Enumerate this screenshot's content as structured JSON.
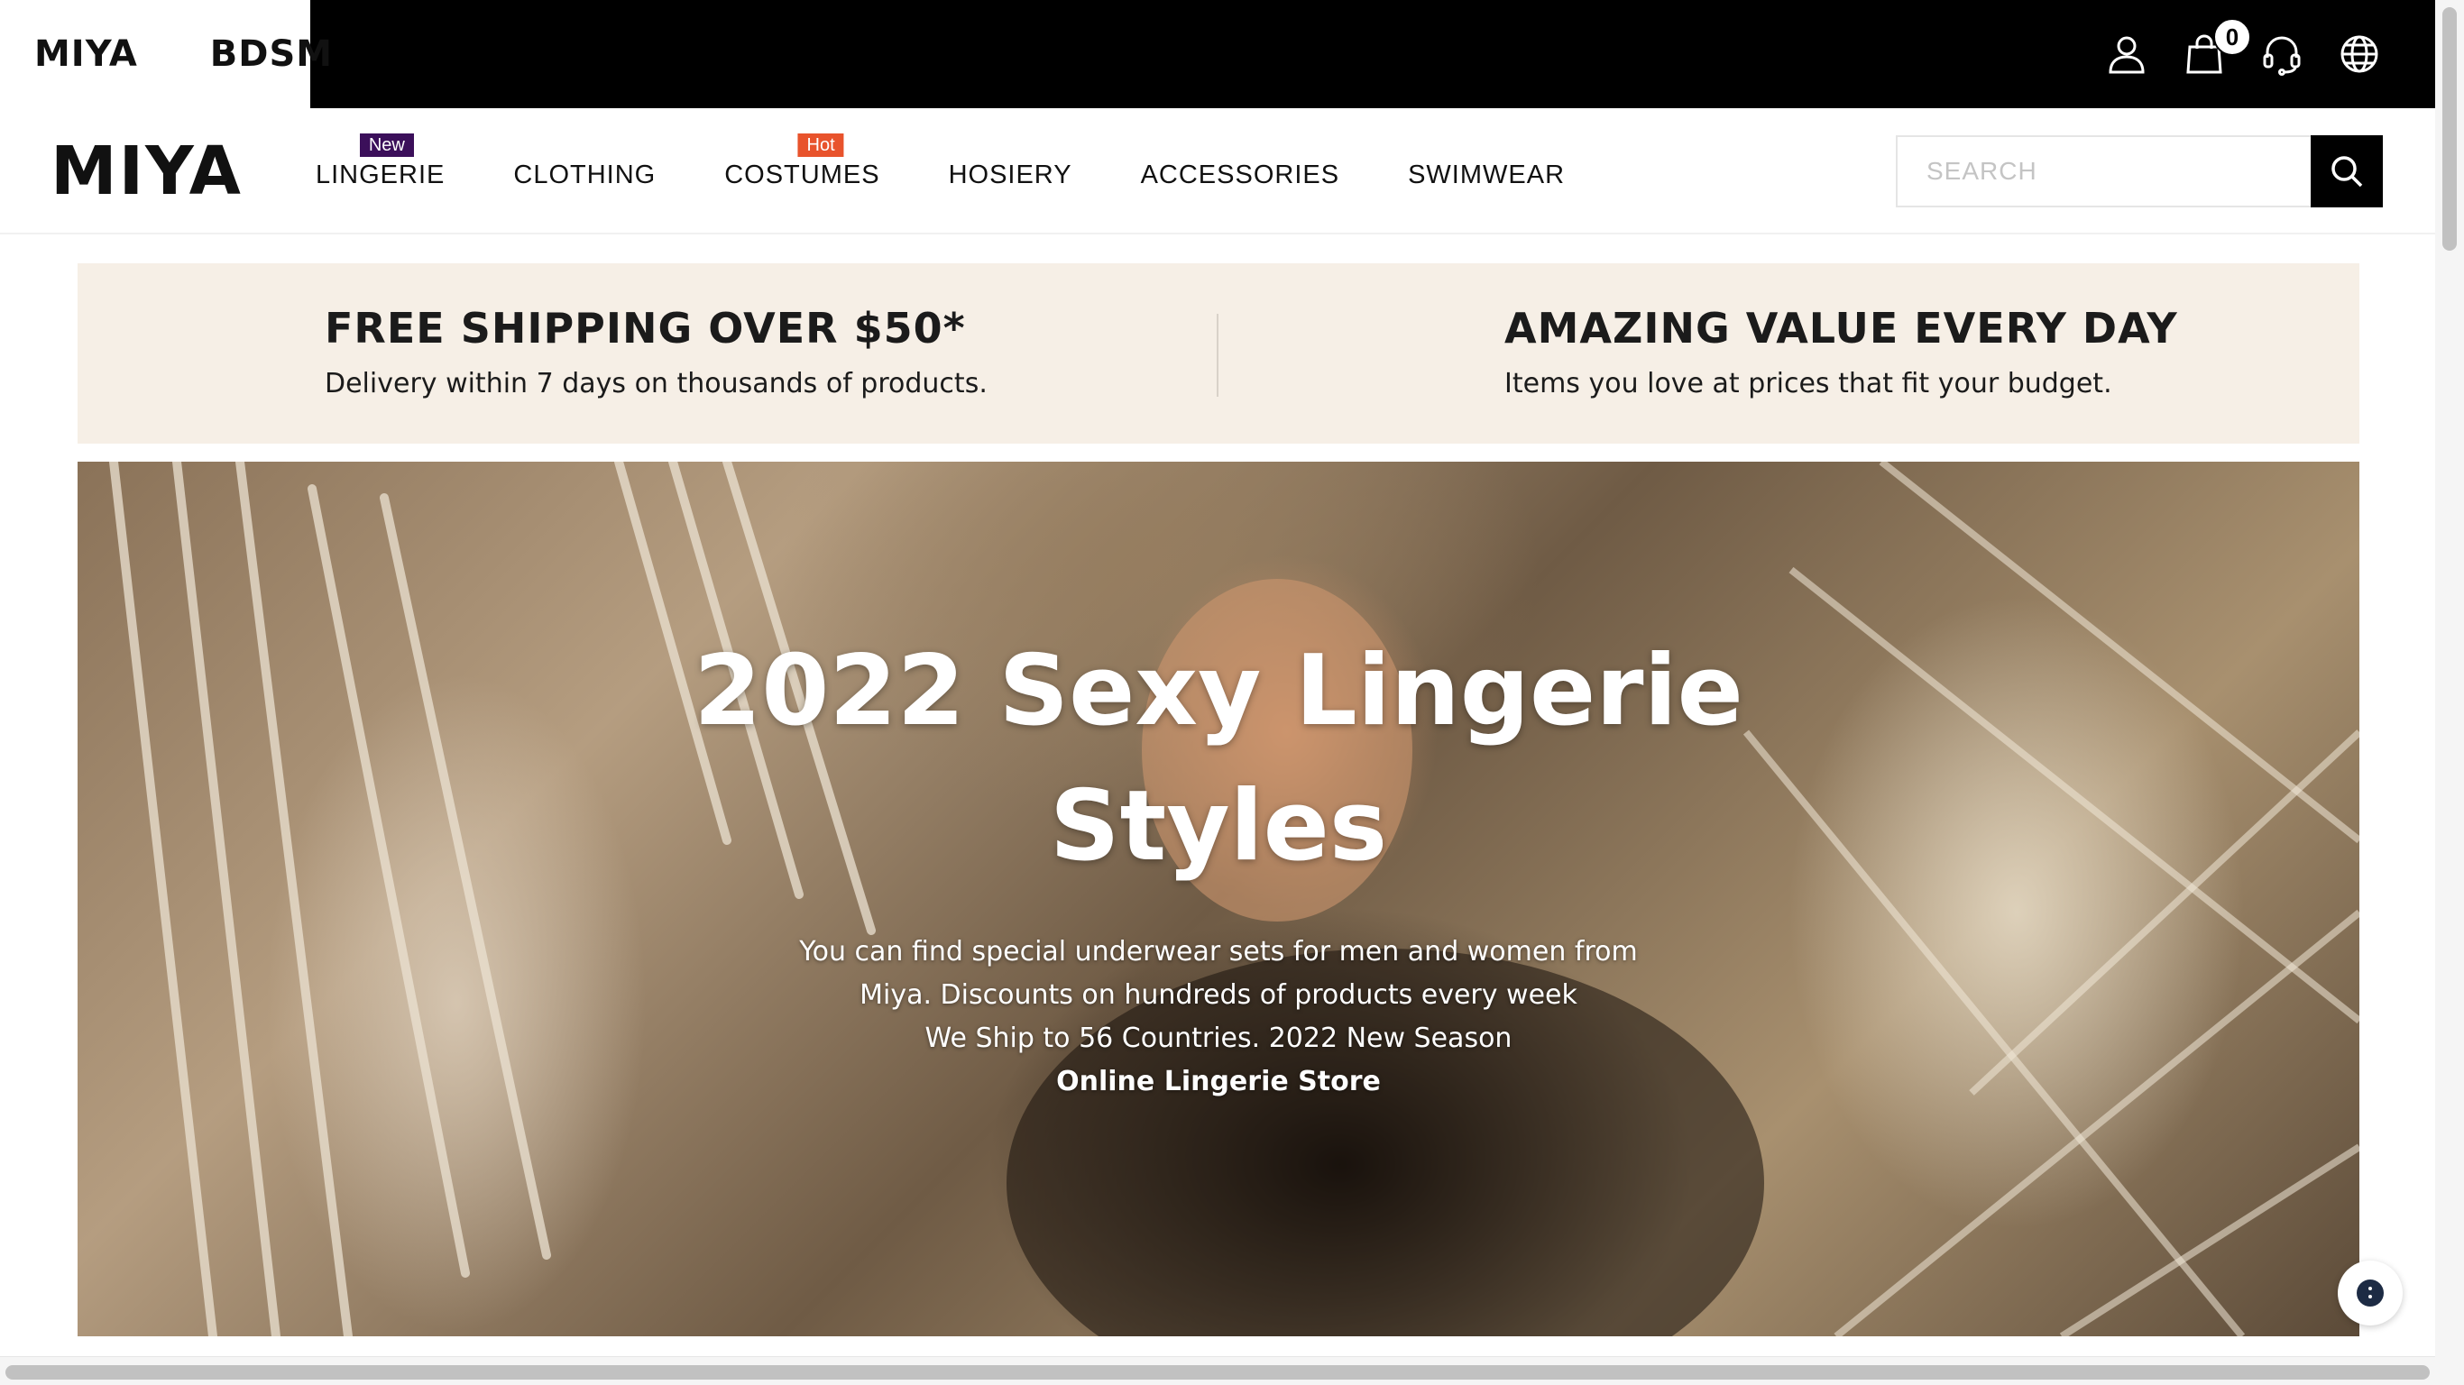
{
  "topbar": {
    "stores": [
      "MIYA",
      "BDSM"
    ],
    "cart_count": "0",
    "icons": [
      "user-icon",
      "shopping-bag-icon",
      "headset-icon",
      "globe-icon"
    ]
  },
  "header": {
    "logo": "MIYA",
    "nav": [
      {
        "label": "LINGERIE",
        "badge": "New"
      },
      {
        "label": "CLOTHING",
        "badge": ""
      },
      {
        "label": "COSTUMES",
        "badge": "Hot"
      },
      {
        "label": "HOSIERY",
        "badge": ""
      },
      {
        "label": "ACCESSORIES",
        "badge": ""
      },
      {
        "label": "SWIMWEAR",
        "badge": ""
      }
    ],
    "search": {
      "placeholder": "SEARCH",
      "value": ""
    }
  },
  "promo": {
    "left": {
      "title": "FREE SHIPPING OVER $50*",
      "subtitle": "Delivery within 7 days on thousands of products."
    },
    "right": {
      "title": "AMAZING VALUE EVERY DAY",
      "subtitle": "Items you love at prices that fit your budget."
    }
  },
  "hero": {
    "title": "2022 Sexy Lingerie Styles",
    "lines": [
      "You can find special underwear sets for men and women from",
      "Miya. Discounts on hundreds of products every week",
      "We Ship to 56 Countries. 2022 New Season"
    ],
    "strong": "Online Lingerie Store"
  },
  "colors": {
    "topbar": "#000000",
    "promo_bg": "#f6efe6",
    "badge_new": "#3b0f5a",
    "badge_hot": "#e8532c"
  }
}
